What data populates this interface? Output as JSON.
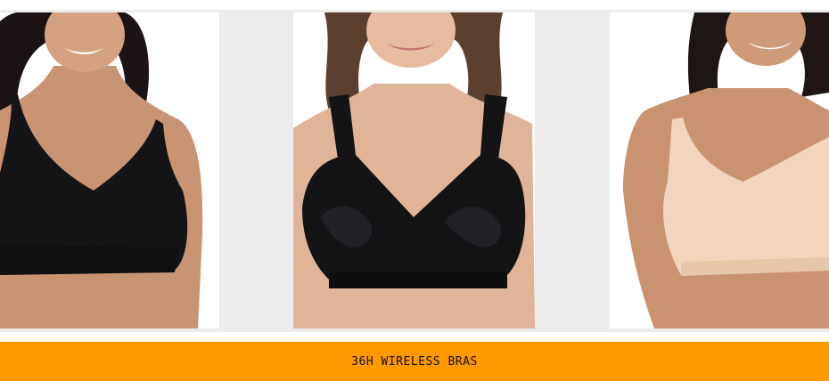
{
  "products": [
    {
      "icon": "product-photo-black-wireless-bra",
      "color": "#151518"
    },
    {
      "icon": "product-photo-black-lace-wireless-bra",
      "color": "#141416"
    },
    {
      "icon": "product-photo-nude-wireless-bra",
      "color": "#f1d6bd"
    }
  ],
  "banner": {
    "label": "36H WIRELESS BRAS",
    "background": "#ff9900"
  }
}
